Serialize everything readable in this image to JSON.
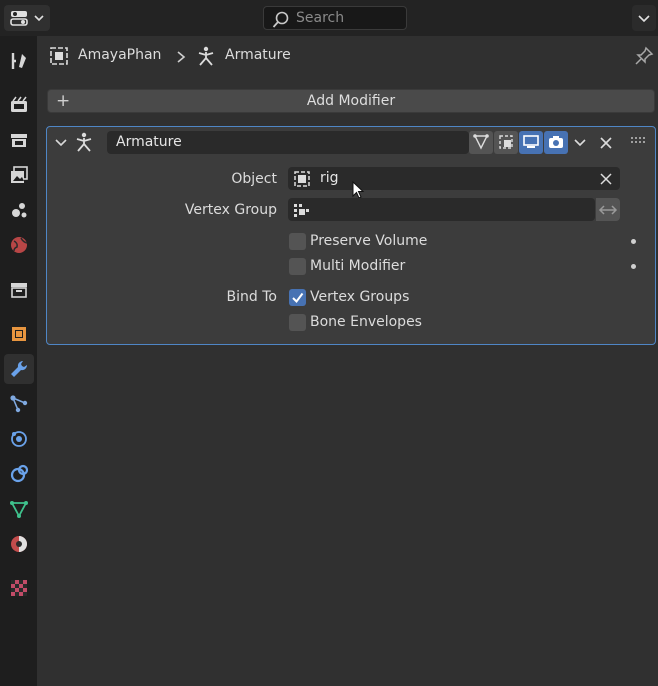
{
  "header": {
    "search_placeholder": "Search"
  },
  "breadcrumb": {
    "object_name": "AmayaPhan",
    "data_name": "Armature"
  },
  "add_modifier_label": "Add Modifier",
  "modifier": {
    "name": "Armature",
    "object_label": "Object",
    "object_value": "rig",
    "vertex_group_label": "Vertex Group",
    "vertex_group_value": "",
    "preserve_volume_label": "Preserve Volume",
    "preserve_volume_checked": false,
    "multi_modifier_label": "Multi Modifier",
    "multi_modifier_checked": false,
    "bind_to_label": "Bind To",
    "vertex_groups_label": "Vertex Groups",
    "vertex_groups_checked": true,
    "bone_envelopes_label": "Bone Envelopes",
    "bone_envelopes_checked": false
  },
  "tabs": [
    "tool",
    "render",
    "output",
    "view-layer",
    "scene",
    "world",
    "collection",
    "object",
    "modifiers",
    "particles",
    "physics",
    "constraints",
    "data",
    "material",
    "texture"
  ],
  "colors": {
    "accent": "#4772b3",
    "panel_border": "#4f86c6"
  }
}
